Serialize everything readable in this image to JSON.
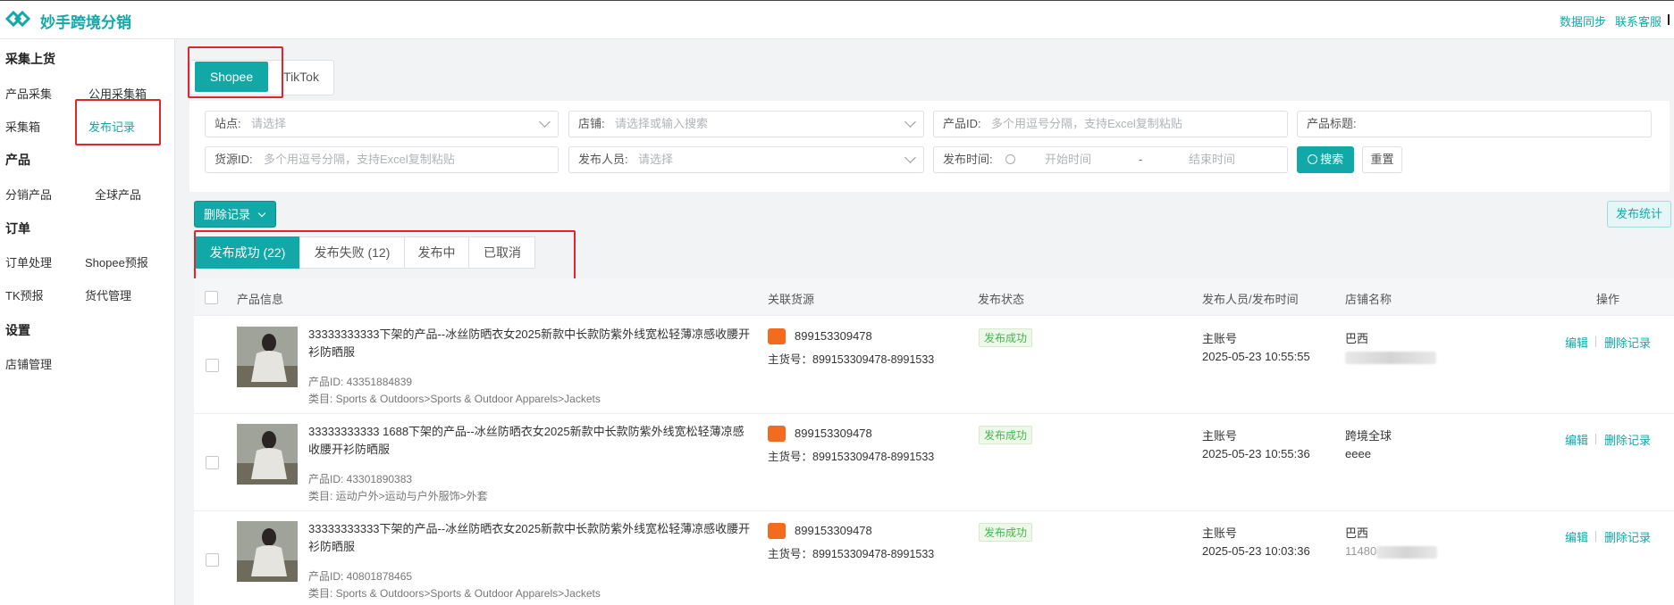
{
  "app": {
    "title": "妙手跨境分销",
    "top_links": [
      "数据同步",
      "联系客服"
    ]
  },
  "sidebar": {
    "sections": [
      {
        "title": "采集上货",
        "items": [
          "产品采集",
          "公用采集箱",
          "采集箱",
          "发布记录"
        ]
      },
      {
        "title": "产品",
        "items": [
          "分销产品",
          "全球产品"
        ]
      },
      {
        "title": "订单",
        "items": [
          "订单处理",
          "Shopee预报",
          "TK预报",
          "货代管理"
        ]
      },
      {
        "title": "设置",
        "items": [
          "店铺管理"
        ]
      }
    ],
    "active_item": "发布记录"
  },
  "platform_tabs": [
    "Shopee",
    "TikTok"
  ],
  "filters": {
    "site": {
      "label": "站点:",
      "placeholder": "请选择"
    },
    "store": {
      "label": "店铺:",
      "placeholder": "请选择或输入搜索"
    },
    "product_id": {
      "label": "产品ID:",
      "placeholder": "多个用逗号分隔，支持Excel复制粘贴"
    },
    "product_title": {
      "label": "产品标题:",
      "placeholder": ""
    },
    "source_id": {
      "label": "货源ID:",
      "placeholder": "多个用逗号分隔，支持Excel复制粘贴"
    },
    "publisher": {
      "label": "发布人员:",
      "placeholder": "请选择"
    },
    "publish_time": {
      "label": "发布时间:",
      "start": "开始时间",
      "sep": "-",
      "end": "结束时间"
    },
    "search_label": "搜索",
    "reset_label": "重置"
  },
  "actions": {
    "delete_records": "删除记录",
    "publish_stats": "发布统计"
  },
  "status_tabs": [
    "发布成功 (22)",
    "发布失败 (12)",
    "发布中",
    "已取消"
  ],
  "table": {
    "columns": [
      "产品信息",
      "关联货源",
      "发布状态",
      "发布人员/发布时间",
      "店铺名称",
      "操作"
    ],
    "rows": [
      {
        "title": "33333333333下架的产品--冰丝防晒衣女2025新款中长款防紫外线宽松轻薄凉感收腰开衫防晒服",
        "product_id": "产品ID: 43351884839",
        "category": "类目: Sports & Outdoors>Sports & Outdoor Apparels>Jackets",
        "source_link": "899153309478",
        "source_sku": "主货号：899153309478-8991533",
        "status": "发布成功",
        "publisher": "主账号",
        "time": "2025-05-23 10:55:55",
        "store": "巴西",
        "store_sub": "",
        "ops": [
          "编辑",
          "删除记录"
        ]
      },
      {
        "title": "33333333333 1688下架的产品--冰丝防晒衣女2025新款中长款防紫外线宽松轻薄凉感收腰开衫防晒服",
        "product_id": "产品ID: 43301890383",
        "category": "类目: 运动户外>运动与户外服饰>外套",
        "source_link": "899153309478",
        "source_sku": "主货号：899153309478-8991533",
        "status": "发布成功",
        "publisher": "主账号",
        "time": "2025-05-23 10:55:36",
        "store": "跨境全球",
        "store_sub": "eeee",
        "ops": [
          "编辑",
          "删除记录"
        ]
      },
      {
        "title": "33333333333下架的产品--冰丝防晒衣女2025新款中长款防紫外线宽松轻薄凉感收腰开衫防晒服",
        "product_id": "产品ID: 40801878465",
        "category": "类目: Sports & Outdoors>Sports & Outdoor Apparels>Jackets",
        "source_link": "899153309478",
        "source_sku": "主货号：899153309478-8991533",
        "status": "发布成功",
        "publisher": "主账号",
        "time": "2025-05-23 10:03:36",
        "store": "巴西",
        "store_sub": "114804",
        "ops": [
          "编辑",
          "删除记录"
        ]
      }
    ]
  },
  "colors": {
    "accent": "#12a8a8",
    "highlight_box": "#e0252b",
    "success": "#45b649"
  }
}
